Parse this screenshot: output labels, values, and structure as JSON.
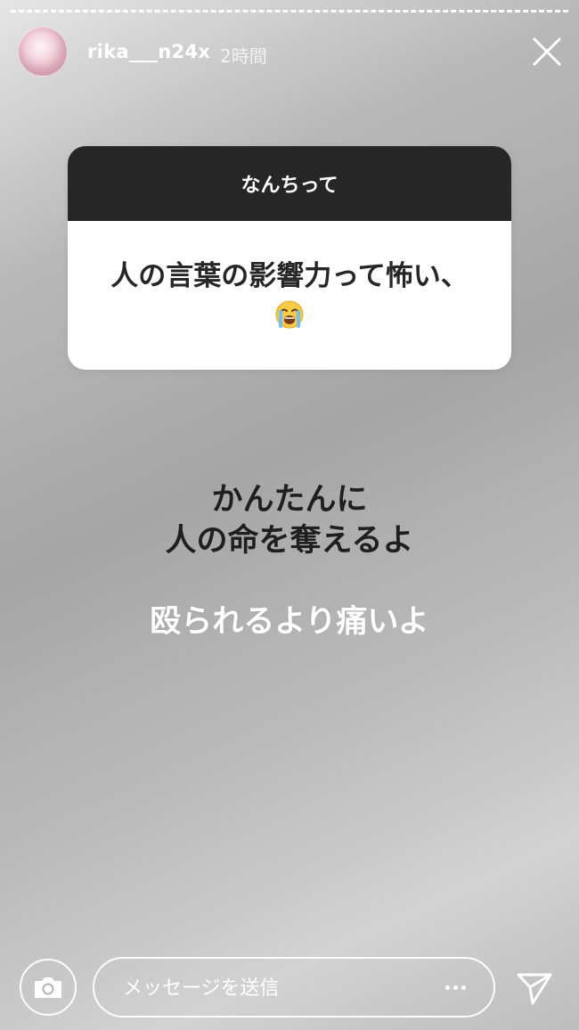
{
  "header": {
    "username": "rika___n24x",
    "time_ago": "2時間"
  },
  "question_card": {
    "question": "なんちって",
    "answer": "人の言葉の影響力って怖い、",
    "answer_emoji_icon": "loudly-crying-face-emoji"
  },
  "overlay_text": {
    "line1": "かんたんに",
    "line2": "人の命を奪えるよ",
    "line3": "殴られるより痛いよ"
  },
  "footer": {
    "message_placeholder": "メッセージを送信",
    "camera_icon": "camera-icon",
    "more_icon": "more-dots-icon",
    "send_icon": "send-icon"
  },
  "colors": {
    "card_header_bg": "#262626",
    "card_body_bg": "#ffffff",
    "text_dark": "#1f1f1f",
    "text_light": "#ffffff"
  }
}
